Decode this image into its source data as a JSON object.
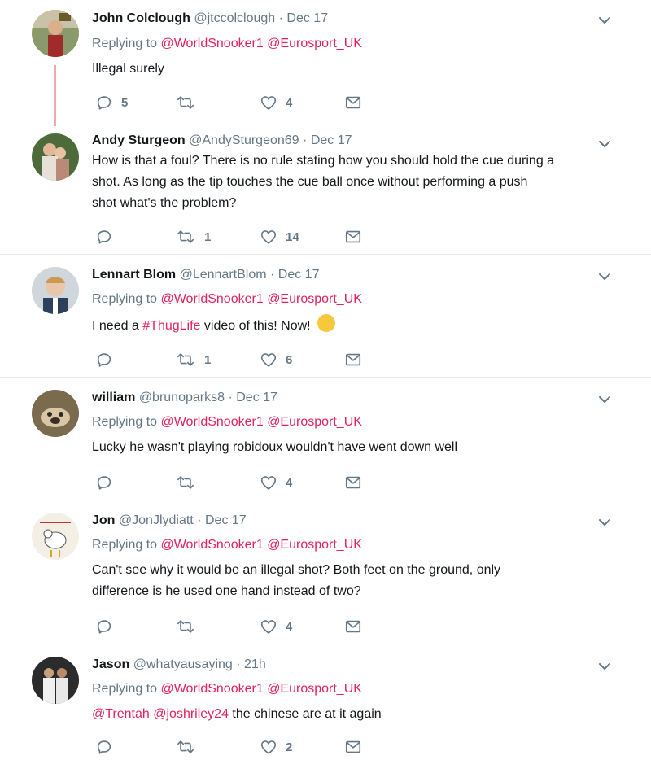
{
  "tweets": [
    {
      "name": "John Colclough",
      "handle": "@jtccolclough",
      "dot": "·",
      "time": "Dec 17",
      "replying_prefix": "Replying to",
      "reply_mentions": [
        "@WorldSnooker1",
        "@Eurosport_UK"
      ],
      "text": "Illegal surely",
      "replies": "5",
      "retweets": "",
      "likes": "4"
    },
    {
      "name": "Andy Sturgeon",
      "handle": "@AndySturgeon69",
      "dot": "·",
      "time": "Dec 17",
      "text_lines": [
        "How is that a foul? There is no rule stating how you should hold the cue during a",
        "shot. As long as the tip touches the cue ball once without performing a push",
        "shot what's the problem?"
      ],
      "replies": "",
      "retweets": "1",
      "likes": "14"
    },
    {
      "name": "Lennart Blom",
      "handle": "@LennartBlom",
      "dot": "·",
      "time": "Dec 17",
      "replying_prefix": "Replying to",
      "reply_mentions": [
        "@WorldSnooker1",
        "@Eurosport_UK"
      ],
      "text_pre": "I need a ",
      "hashtag": "#ThugLife",
      "text_post": " video of this! Now!",
      "emoji": "😂",
      "replies": "",
      "retweets": "1",
      "likes": "6"
    },
    {
      "name": "william",
      "handle": "@brunoparks8",
      "dot": "·",
      "time": "Dec 17",
      "replying_prefix": "Replying to",
      "reply_mentions": [
        "@WorldSnooker1",
        "@Eurosport_UK"
      ],
      "text": "Lucky he wasn't playing robidoux wouldn't have went down well",
      "replies": "",
      "retweets": "",
      "likes": "4"
    },
    {
      "name": "Jon",
      "handle": "@JonJlydiatt",
      "dot": "·",
      "time": "Dec 17",
      "replying_prefix": "Replying to",
      "reply_mentions": [
        "@WorldSnooker1",
        "@Eurosport_UK"
      ],
      "text_lines": [
        "Can't see why it would be an illegal shot? Both feet on the ground, only",
        "difference is he used one hand instead of two?"
      ],
      "replies": "",
      "retweets": "",
      "likes": "4"
    },
    {
      "name": "Jason",
      "handle": "@whatyausaying",
      "dot": "·",
      "time": "21h",
      "replying_prefix": "Replying to",
      "reply_mentions": [
        "@WorldSnooker1",
        "@Eurosport_UK"
      ],
      "text_mentions": [
        "@Trentah",
        "@joshriley24"
      ],
      "text_post": " the chinese are at it again",
      "replies": "",
      "retweets": "",
      "likes": "2"
    }
  ],
  "icons": {
    "reply": "reply-icon",
    "retweet": "retweet-icon",
    "like": "heart-icon",
    "dm": "envelope-icon",
    "caret": "chevron-down-icon"
  },
  "colors": {
    "accent": "#e0245e",
    "muted": "#657786",
    "text": "#14171a",
    "divider": "#e6ecf0"
  }
}
